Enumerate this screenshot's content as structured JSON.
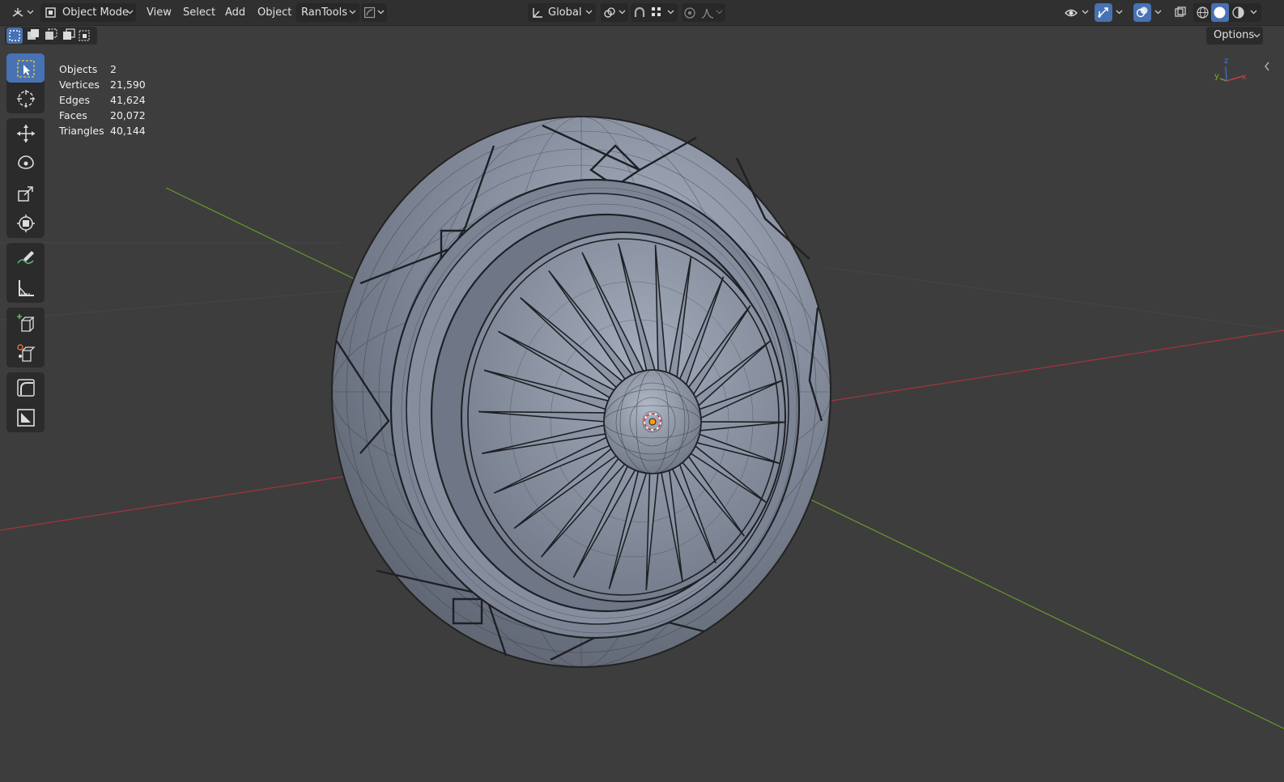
{
  "header": {
    "mode_label": "Object Mode",
    "menus": [
      "View",
      "Select",
      "Add",
      "Object",
      "RanTools"
    ],
    "orientation_label": "Global"
  },
  "options_label": "Options",
  "stats": [
    {
      "label": "Objects",
      "value": "2"
    },
    {
      "label": "Vertices",
      "value": "21,590"
    },
    {
      "label": "Edges",
      "value": "41,624"
    },
    {
      "label": "Faces",
      "value": "20,072"
    },
    {
      "label": "Triangles",
      "value": "40,144"
    }
  ],
  "gizmo": {
    "x": "x",
    "y": "y",
    "z": "z"
  },
  "icons": [
    "editor-type-icon",
    "object-mode-icon",
    "select-box-icon",
    "cursor-icon",
    "move-icon",
    "rotate-icon",
    "scale-icon",
    "transform-icon",
    "annotate-icon",
    "measure-icon",
    "add-cube-icon",
    "add-object-icon",
    "curve-tool-icon",
    "image-tool-icon",
    "transform-orientation-icon",
    "pivot-icon",
    "snap-icon",
    "proportional-edit-icon",
    "visibility-icon",
    "gizmo-icon",
    "overlay-icon",
    "xray-icon",
    "wireframe-shading-icon",
    "solid-shading-icon",
    "material-shading-icon"
  ],
  "colors": {
    "background": "#3d3d3d",
    "header": "#303030",
    "active": "#4772b3",
    "x_axis": "#a5343f",
    "y_axis": "#6a9a2a",
    "origin": "#ff9a18"
  }
}
